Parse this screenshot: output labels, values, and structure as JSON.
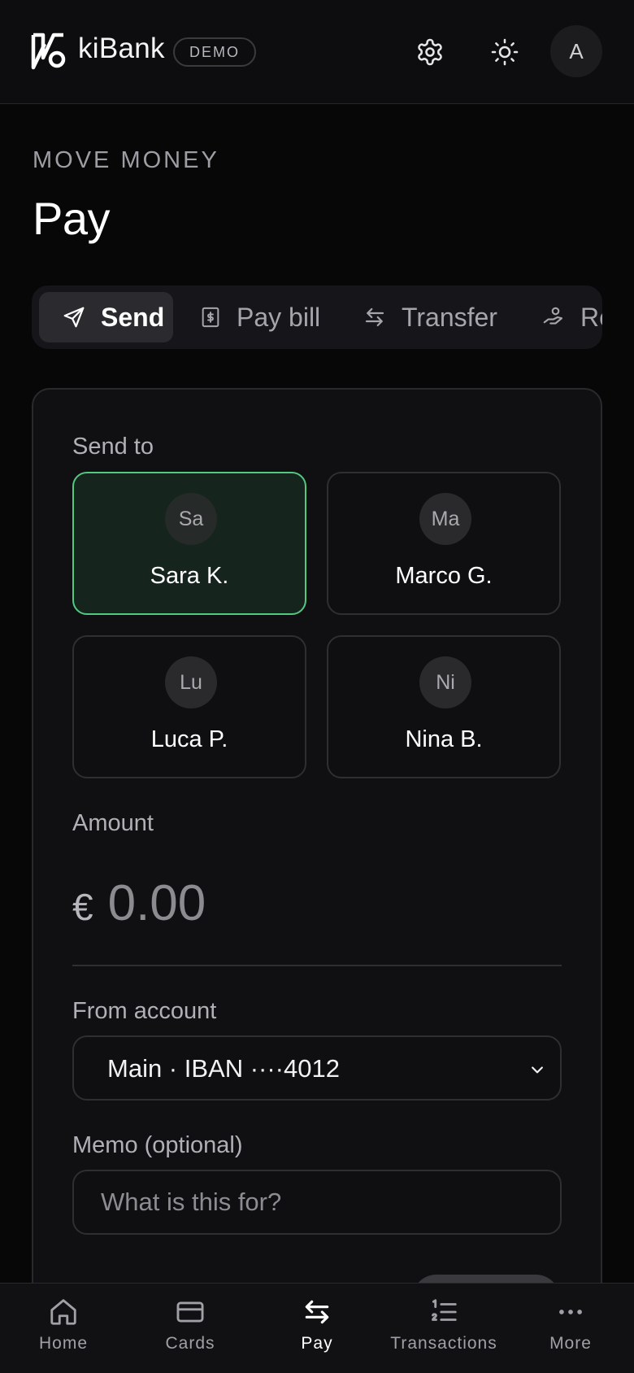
{
  "header": {
    "brand": "kiBank",
    "badge": "DEMO",
    "avatar_initial": "A",
    "icons": [
      "settings-gear-icon",
      "theme-sun-icon"
    ]
  },
  "page": {
    "eyebrow": "MOVE MONEY",
    "title": "Pay"
  },
  "tabs": [
    {
      "label": "Send",
      "icon": "send-paper-plane-icon",
      "active": true
    },
    {
      "label": "Pay bill",
      "icon": "bill-receipt-icon",
      "active": false
    },
    {
      "label": "Transfer",
      "icon": "transfer-arrows-icon",
      "active": false
    },
    {
      "label": "Re",
      "icon": "request-hand-icon",
      "active": false
    }
  ],
  "send_form": {
    "send_to_label": "Send to",
    "recipients": [
      {
        "initials": "Sa",
        "name": "Sara K.",
        "selected": true
      },
      {
        "initials": "Ma",
        "name": "Marco G.",
        "selected": false
      },
      {
        "initials": "Lu",
        "name": "Luca P.",
        "selected": false
      },
      {
        "initials": "Ni",
        "name": "Nina B.",
        "selected": false
      }
    ],
    "amount_label": "Amount",
    "currency_symbol": "€",
    "amount_placeholder": "0.00",
    "from_account_label": "From account",
    "from_account_value": "Main · IBAN ····4012",
    "memo_label": "Memo (optional)",
    "memo_placeholder": "What is this for?"
  },
  "bottom_nav": [
    {
      "label": "Home",
      "icon": "home-icon",
      "active": false
    },
    {
      "label": "Cards",
      "icon": "card-icon",
      "active": false
    },
    {
      "label": "Pay",
      "icon": "pay-arrows-icon",
      "active": true
    },
    {
      "label": "Transactions",
      "icon": "numbered-list-icon",
      "active": false
    },
    {
      "label": "More",
      "icon": "more-dots-icon",
      "active": false
    }
  ],
  "colors": {
    "background": "#070708",
    "surface": "#101012",
    "accent_green": "#53c881",
    "selected_fill": "#16241e"
  }
}
